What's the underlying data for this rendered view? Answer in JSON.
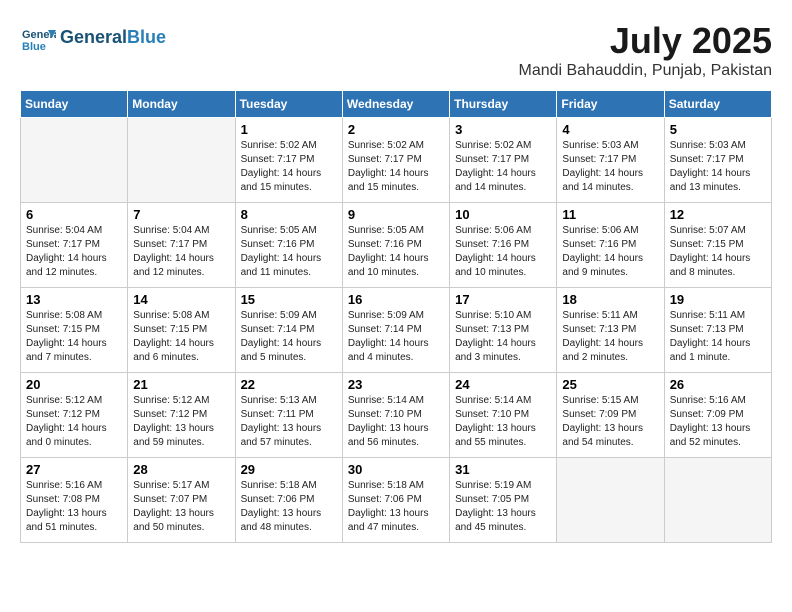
{
  "header": {
    "logo_line1": "General",
    "logo_line2": "Blue",
    "month_title": "July 2025",
    "location": "Mandi Bahauddin, Punjab, Pakistan"
  },
  "weekdays": [
    "Sunday",
    "Monday",
    "Tuesday",
    "Wednesday",
    "Thursday",
    "Friday",
    "Saturday"
  ],
  "weeks": [
    [
      {
        "day": "",
        "info": ""
      },
      {
        "day": "",
        "info": ""
      },
      {
        "day": "1",
        "info": "Sunrise: 5:02 AM\nSunset: 7:17 PM\nDaylight: 14 hours and 15 minutes."
      },
      {
        "day": "2",
        "info": "Sunrise: 5:02 AM\nSunset: 7:17 PM\nDaylight: 14 hours and 15 minutes."
      },
      {
        "day": "3",
        "info": "Sunrise: 5:02 AM\nSunset: 7:17 PM\nDaylight: 14 hours and 14 minutes."
      },
      {
        "day": "4",
        "info": "Sunrise: 5:03 AM\nSunset: 7:17 PM\nDaylight: 14 hours and 14 minutes."
      },
      {
        "day": "5",
        "info": "Sunrise: 5:03 AM\nSunset: 7:17 PM\nDaylight: 14 hours and 13 minutes."
      }
    ],
    [
      {
        "day": "6",
        "info": "Sunrise: 5:04 AM\nSunset: 7:17 PM\nDaylight: 14 hours and 12 minutes."
      },
      {
        "day": "7",
        "info": "Sunrise: 5:04 AM\nSunset: 7:17 PM\nDaylight: 14 hours and 12 minutes."
      },
      {
        "day": "8",
        "info": "Sunrise: 5:05 AM\nSunset: 7:16 PM\nDaylight: 14 hours and 11 minutes."
      },
      {
        "day": "9",
        "info": "Sunrise: 5:05 AM\nSunset: 7:16 PM\nDaylight: 14 hours and 10 minutes."
      },
      {
        "day": "10",
        "info": "Sunrise: 5:06 AM\nSunset: 7:16 PM\nDaylight: 14 hours and 10 minutes."
      },
      {
        "day": "11",
        "info": "Sunrise: 5:06 AM\nSunset: 7:16 PM\nDaylight: 14 hours and 9 minutes."
      },
      {
        "day": "12",
        "info": "Sunrise: 5:07 AM\nSunset: 7:15 PM\nDaylight: 14 hours and 8 minutes."
      }
    ],
    [
      {
        "day": "13",
        "info": "Sunrise: 5:08 AM\nSunset: 7:15 PM\nDaylight: 14 hours and 7 minutes."
      },
      {
        "day": "14",
        "info": "Sunrise: 5:08 AM\nSunset: 7:15 PM\nDaylight: 14 hours and 6 minutes."
      },
      {
        "day": "15",
        "info": "Sunrise: 5:09 AM\nSunset: 7:14 PM\nDaylight: 14 hours and 5 minutes."
      },
      {
        "day": "16",
        "info": "Sunrise: 5:09 AM\nSunset: 7:14 PM\nDaylight: 14 hours and 4 minutes."
      },
      {
        "day": "17",
        "info": "Sunrise: 5:10 AM\nSunset: 7:13 PM\nDaylight: 14 hours and 3 minutes."
      },
      {
        "day": "18",
        "info": "Sunrise: 5:11 AM\nSunset: 7:13 PM\nDaylight: 14 hours and 2 minutes."
      },
      {
        "day": "19",
        "info": "Sunrise: 5:11 AM\nSunset: 7:13 PM\nDaylight: 14 hours and 1 minute."
      }
    ],
    [
      {
        "day": "20",
        "info": "Sunrise: 5:12 AM\nSunset: 7:12 PM\nDaylight: 14 hours and 0 minutes."
      },
      {
        "day": "21",
        "info": "Sunrise: 5:12 AM\nSunset: 7:12 PM\nDaylight: 13 hours and 59 minutes."
      },
      {
        "day": "22",
        "info": "Sunrise: 5:13 AM\nSunset: 7:11 PM\nDaylight: 13 hours and 57 minutes."
      },
      {
        "day": "23",
        "info": "Sunrise: 5:14 AM\nSunset: 7:10 PM\nDaylight: 13 hours and 56 minutes."
      },
      {
        "day": "24",
        "info": "Sunrise: 5:14 AM\nSunset: 7:10 PM\nDaylight: 13 hours and 55 minutes."
      },
      {
        "day": "25",
        "info": "Sunrise: 5:15 AM\nSunset: 7:09 PM\nDaylight: 13 hours and 54 minutes."
      },
      {
        "day": "26",
        "info": "Sunrise: 5:16 AM\nSunset: 7:09 PM\nDaylight: 13 hours and 52 minutes."
      }
    ],
    [
      {
        "day": "27",
        "info": "Sunrise: 5:16 AM\nSunset: 7:08 PM\nDaylight: 13 hours and 51 minutes."
      },
      {
        "day": "28",
        "info": "Sunrise: 5:17 AM\nSunset: 7:07 PM\nDaylight: 13 hours and 50 minutes."
      },
      {
        "day": "29",
        "info": "Sunrise: 5:18 AM\nSunset: 7:06 PM\nDaylight: 13 hours and 48 minutes."
      },
      {
        "day": "30",
        "info": "Sunrise: 5:18 AM\nSunset: 7:06 PM\nDaylight: 13 hours and 47 minutes."
      },
      {
        "day": "31",
        "info": "Sunrise: 5:19 AM\nSunset: 7:05 PM\nDaylight: 13 hours and 45 minutes."
      },
      {
        "day": "",
        "info": ""
      },
      {
        "day": "",
        "info": ""
      }
    ]
  ]
}
